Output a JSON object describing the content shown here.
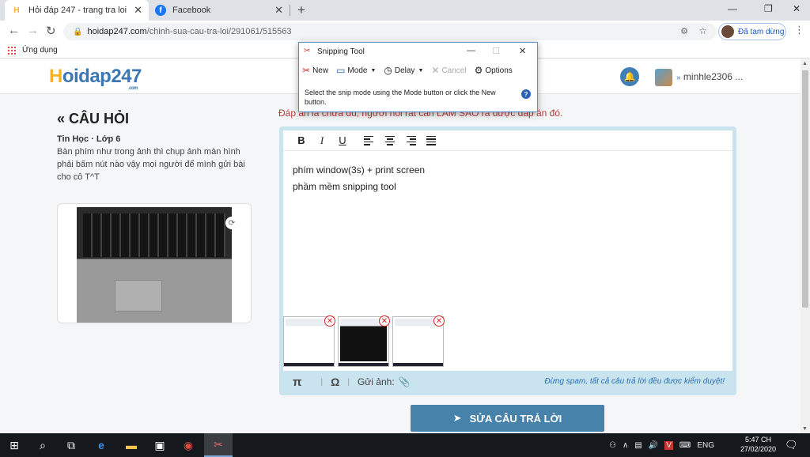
{
  "browser": {
    "tabs": [
      {
        "title": "Hỏi đáp 247 - trang tra loi",
        "favicon": "H"
      },
      {
        "title": "Facebook",
        "favicon": "f"
      }
    ],
    "new_tab": "+",
    "url_host": "hoidap247.com",
    "url_path": "/chinh-sua-cau-tra-loi/291061/515563",
    "profile_status": "Đã tạm dừng",
    "bookmarks_label": "Ứng dụng"
  },
  "site": {
    "logo_h": "H",
    "logo_rest": "oidap247",
    "logo_sub": ".com",
    "username": "minhle2306 ..."
  },
  "question": {
    "heading": "« CÂU HỎI",
    "subject": "Tin Học · Lớp 6",
    "body": "Bàn phím như trong ảnh thì chụp ảnh màn hình phải bấm nút nào vậy mọi người để mình gửi bài cho cô T^T"
  },
  "answer": {
    "note": "Đáp án là chưa đủ, người hỏi rất cần LÀM SAO ra được đáp án đó.",
    "lines": [
      "phím window(3s) + print screen",
      "phầm mềm snipping tool"
    ],
    "gui_anh": "Gửi ảnh:",
    "spam_note": "Đừng spam, tất cả câu trả lời đều được kiểm duyệt!",
    "submit_label": "SỬA CÂU TRẢ LỜI"
  },
  "snipping_tool": {
    "title": "Snipping Tool",
    "buttons": {
      "new": "New",
      "mode": "Mode",
      "delay": "Delay",
      "cancel": "Cancel",
      "options": "Options"
    },
    "message": "Select the snip mode using the Mode button or click the New button."
  },
  "taskbar": {
    "time": "5:47 CH",
    "date": "27/02/2020",
    "language": "ENG"
  },
  "colors": {
    "brand_blue": "#3a77b5",
    "logo_yellow": "#f3b32a",
    "submit_blue": "#4782ab",
    "warning_red": "#b83a3a"
  }
}
